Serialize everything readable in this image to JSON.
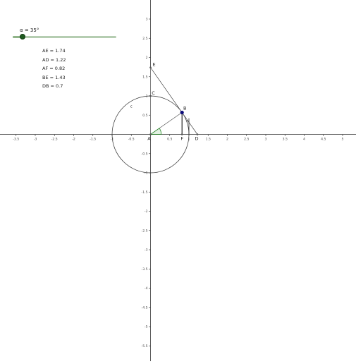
{
  "slider": {
    "label": "α = 35°",
    "value_fraction": 0.097
  },
  "measurements": [
    "AE = 1.74",
    "AD = 1.22",
    "AF = 0.82",
    "BE = 1.43",
    "DB = 0.7"
  ],
  "axes": {
    "x_ticks": [
      "-3.5",
      "-3",
      "-2.5",
      "-2",
      "-1.5",
      "-1",
      "-0.5",
      "0.5",
      "1",
      "1.5",
      "2",
      "2.5",
      "3",
      "3.5",
      "4",
      "4.5",
      "5"
    ],
    "y_ticks": [
      "3",
      "2.5",
      "2",
      "1.5",
      "1",
      "0.5",
      "-0.5",
      "-1",
      "-1.5",
      "-2",
      "-2.5",
      "-3",
      "-3.5",
      "-4",
      "-4.5",
      "-5",
      "-5.5"
    ],
    "x_range": [
      -3.7,
      5.1
    ],
    "y_range": [
      -5.6,
      3.5
    ]
  },
  "figure": {
    "angle_deg": 35,
    "points": {
      "A": {
        "label": "A",
        "x": 0,
        "y": 0
      },
      "B": {
        "label": "B",
        "x": 0.82,
        "y": 0.57
      },
      "C": {
        "label": "C",
        "x": 0,
        "y": 1
      },
      "D": {
        "label": "D",
        "x": 1.22,
        "y": 0
      },
      "E": {
        "label": "E",
        "x": 0,
        "y": 1.74
      },
      "F": {
        "label": "F",
        "x": 0.82,
        "y": 0
      }
    },
    "circle_label": "c",
    "circle_radius": 1,
    "segment_label": "f",
    "colors": {
      "axis": "#333333",
      "circle": "#333333",
      "point": "#1a1a8c",
      "point_b": "#0b0b7a",
      "angle": "#2a8a2a",
      "lines": "#444444"
    }
  }
}
